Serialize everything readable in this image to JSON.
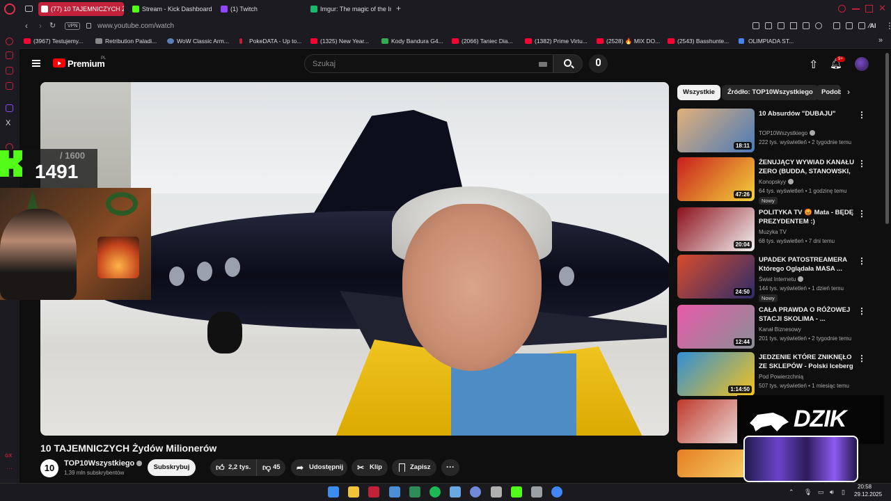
{
  "browser": {
    "tabs": [
      {
        "label": "(77) 10 TAJEMNICZYCH Ż",
        "color": "#ff0033"
      },
      {
        "label": "Stream - Kick Dashboard",
        "color": "#53fc18"
      },
      {
        "label": "(1) Twitch",
        "color": "#9146ff"
      },
      {
        "label": "Imgur: The magic of the In",
        "color": "#1bb76e"
      }
    ],
    "new_tab_label": "+",
    "vpn_label": "VPN",
    "url": "www.youtube.com/watch",
    "ai_label": "AI",
    "bookmarks": [
      {
        "label": "(3967) Testujemy...",
        "color": "#ff0033"
      },
      {
        "label": "Retribution Paladi...",
        "color": "#888888"
      },
      {
        "label": "WoW Classic Arm...",
        "color": "#5a7fb5"
      },
      {
        "label": "PokeDATA - Up to...",
        "color": "#c3213a"
      },
      {
        "label": "(1325) New Year...",
        "color": "#ff0033"
      },
      {
        "label": "Kody Bandura G4...",
        "color": "#34a853"
      },
      {
        "label": "(2066) Taniec Dia...",
        "color": "#ff0033"
      },
      {
        "label": "(1382) Prime Virtu...",
        "color": "#ff0033"
      },
      {
        "label": "(2528) 🔥 MIX DO...",
        "color": "#ff0033"
      },
      {
        "label": "(2543) Basshunte...",
        "color": "#ff0033"
      },
      {
        "label": "OLIMPIADA ST...",
        "color": "#4285f4"
      }
    ]
  },
  "youtube": {
    "brand": "Premium",
    "region": "PL",
    "search_placeholder": "Szukaj",
    "notifications_badge": "9+"
  },
  "stream_overlay": {
    "goal_max": "/ 1600",
    "goal_current": "1491"
  },
  "video": {
    "title": "10 TAJEMNICZYCH Żydów Milionerów",
    "channel_avatar_text": "10",
    "channel_name": "TOP10Wszystkiego",
    "subscribers": "1,39 mln subskrybentów",
    "subscribe_label": "Subskrybuj",
    "likes": "2,2 tys.",
    "dislikes": "45",
    "share_label": "Udostępnij",
    "clip_label": "Klip",
    "save_label": "Zapisz"
  },
  "chips": [
    "Wszystkie",
    "Źródło: TOP10Wszystkiego",
    "Podobne"
  ],
  "recommendations": [
    {
      "title": "10 Absurdów \"DUBAJU\"",
      "channel": "TOP10Wszystkiego",
      "verified": true,
      "meta": "222 tys. wyświetleń • 2 tygodnie temu",
      "duration": "18:11",
      "badge": "",
      "colors": [
        "#e1b07a",
        "#4a7ab8"
      ]
    },
    {
      "title": "ŻENUJĄCY WYWIAD KANAŁU ZERO (BUDDA, STANOWSKI, ...",
      "channel": "Konopskyy",
      "verified": true,
      "meta": "64 tys. wyświetleń • 1 godzinę temu",
      "duration": "47:26",
      "badge": "Nowy",
      "colors": [
        "#c81e1e",
        "#f3d33a"
      ]
    },
    {
      "title": "POLITYKA TV 😡 Mata - BĘDĘ PREZYDENTEM :) (#MATA204...",
      "channel": "Muzyka TV",
      "verified": false,
      "meta": "68 tys. wyświetleń • 7 dni temu",
      "duration": "20:04",
      "badge": "",
      "colors": [
        "#8c0f1a",
        "#f2f2f2"
      ]
    },
    {
      "title": "UPADEK PATOSTREAMERA Którego Oglądała MASA ...",
      "channel": "Świat Internetu",
      "verified": true,
      "meta": "144 tys. wyświetleń • 1 dzień temu",
      "duration": "24:50",
      "badge": "Nowy",
      "colors": [
        "#d94b2b",
        "#2c2c6a"
      ]
    },
    {
      "title": "CAŁA PRAWDA O RÓŻOWEJ STACJI SKOLIMA - ...",
      "channel": "Kanał Biznesowy",
      "verified": false,
      "meta": "201 tys. wyświetleń • 2 tygodnie temu",
      "duration": "12:44",
      "badge": "",
      "colors": [
        "#e85aa8",
        "#8a8f96"
      ]
    },
    {
      "title": "JEDZENIE KTÓRE ZNIKNĘŁO ZE SKLEPÓW - Polski Iceberg",
      "channel": "Pod Powierzchnią",
      "verified": false,
      "meta": "507 tys. wyświetleń • 1 miesiąc temu",
      "duration": "1:14:50",
      "badge": "",
      "colors": [
        "#2f8fd6",
        "#f5c21b"
      ]
    },
    {
      "title": "",
      "channel": "",
      "verified": false,
      "meta": "",
      "duration": "",
      "badge": "",
      "colors": [
        "#c0392b",
        "#f1f1f1"
      ]
    },
    {
      "title": "",
      "channel": "",
      "verified": false,
      "meta": "",
      "duration": "",
      "badge": "",
      "colors": [
        "#e67e22",
        "#f7d36b"
      ]
    }
  ],
  "dzik_overlay": {
    "label": "DZIK"
  },
  "taskbar": {
    "time": "20:58",
    "date": "29.12.2025",
    "apps": [
      "#3b8ef0",
      "#f2c23b",
      "#c3213a",
      "#4a8fd6",
      "#2e8b57",
      "#1db954",
      "#6aa6e0",
      "#7289da",
      "#b0b0b0",
      "#53fc18",
      "#9aa0a6",
      "#4285f4"
    ]
  }
}
